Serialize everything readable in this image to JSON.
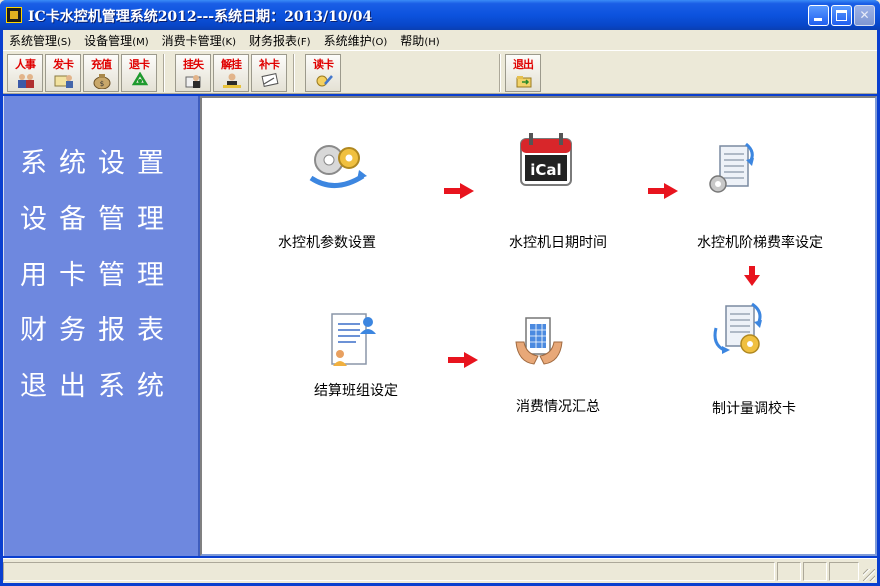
{
  "window": {
    "title": "IC卡水控机管理系统2012---系统日期：2013/10/04",
    "minimize_icon": "minimize-icon",
    "maximize_icon": "maximize-icon",
    "close_icon": "close-icon"
  },
  "menubar": {
    "items": [
      {
        "label": "系统管理",
        "mnemonic": "(S)"
      },
      {
        "label": "设备管理",
        "mnemonic": "(M)"
      },
      {
        "label": "消费卡管理",
        "mnemonic": "(K)"
      },
      {
        "label": "财务报表",
        "mnemonic": "(F)"
      },
      {
        "label": "系统维护",
        "mnemonic": "(O)"
      },
      {
        "label": "帮助",
        "mnemonic": "(H)"
      }
    ]
  },
  "toolbar": {
    "buttons": [
      {
        "label": "人事",
        "icon": "people-icon"
      },
      {
        "label": "发卡",
        "icon": "issue-card-icon"
      },
      {
        "label": "充值",
        "icon": "money-bag-icon"
      },
      {
        "label": "退卡",
        "icon": "recycle-icon"
      },
      {
        "label": "挂失",
        "icon": "report-loss-icon"
      },
      {
        "label": "解挂",
        "icon": "unlock-person-icon"
      },
      {
        "label": "补卡",
        "icon": "replace-card-icon"
      },
      {
        "label": "读卡",
        "icon": "read-card-icon"
      },
      {
        "label": "退出",
        "icon": "exit-folder-icon"
      }
    ]
  },
  "leftnav": {
    "items": [
      "系统设置",
      "设备管理",
      "用卡管理",
      "财务报表",
      "退出系统"
    ]
  },
  "modules": {
    "params": {
      "label": "水控机参数设置",
      "icon": "gears-icon"
    },
    "datetime": {
      "label": "水控机日期时间",
      "icon": "ical-calendar-icon"
    },
    "tiered_rate": {
      "label": "水控机阶梯费率设定",
      "icon": "document-gear-icon"
    },
    "shift_group": {
      "label": "结算班组设定",
      "icon": "document-person-icon"
    },
    "consumption": {
      "label": "消费情况汇总",
      "icon": "hands-report-icon"
    },
    "calibration_card": {
      "label": "制计量调校卡",
      "icon": "document-gear-refresh-icon"
    }
  },
  "colors": {
    "titlebar": "#0c53de",
    "leftnav": "#6e88df",
    "arrow": "#e8141e",
    "toolbar_label": "#e00000"
  }
}
